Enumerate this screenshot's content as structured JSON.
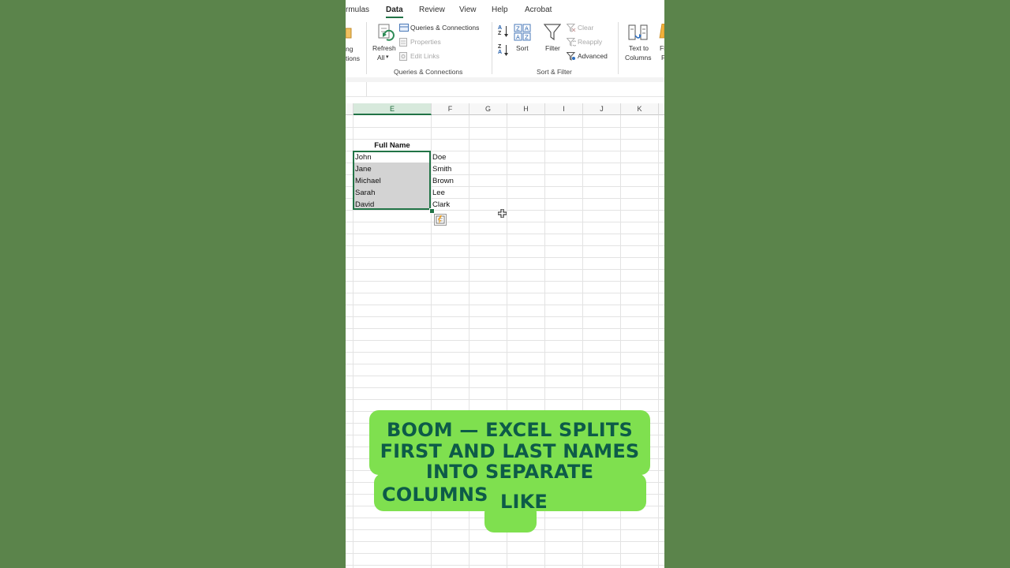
{
  "ribbon": {
    "tabs": [
      "rmulas",
      "Data",
      "Review",
      "View",
      "Help",
      "Acrobat"
    ],
    "active_tab": "Data",
    "left_cut": {
      "line1": "ng",
      "line2": "tions"
    },
    "refresh": {
      "line1": "Refresh",
      "line2": "All",
      "arrow": "▾"
    },
    "queries_connections": "Queries & Connections",
    "properties": "Properties",
    "edit_links": "Edit Links",
    "group_queries": "Queries & Connections",
    "sort": "Sort",
    "filter": "Filter",
    "clear": "Clear",
    "reapply": "Reapply",
    "advanced": "Advanced",
    "group_sort_filter": "Sort & Filter",
    "text_to_columns": {
      "line1": "Text to",
      "line2": "Columns"
    },
    "right_cut": {
      "line1": "Fl",
      "line2": "F"
    },
    "sort_az": {
      "top": "A",
      "bottom": "Z"
    },
    "sort_za": {
      "top": "Z",
      "bottom": "A"
    }
  },
  "sheet": {
    "columns": [
      "E",
      "F",
      "G",
      "H",
      "I",
      "J",
      "K"
    ],
    "selected_column": "E",
    "header": "Full Name",
    "first_names": [
      "John",
      "Jane",
      "Michael",
      "Sarah",
      "David"
    ],
    "last_names": [
      "Doe",
      "Smith",
      "Brown",
      "Lee",
      "Clark"
    ]
  },
  "caption": {
    "line1": "BOOM — EXCEL SPLITS",
    "line2": "FIRST AND LAST NAMES",
    "line3": "INTO SEPARATE",
    "line4a": "COLUMNS",
    "line4b": "LIKE"
  },
  "colors": {
    "background": "#5b844b",
    "excel_green": "#217346",
    "caption_bg": "#7fe04f",
    "caption_text": "#0d5b48"
  }
}
